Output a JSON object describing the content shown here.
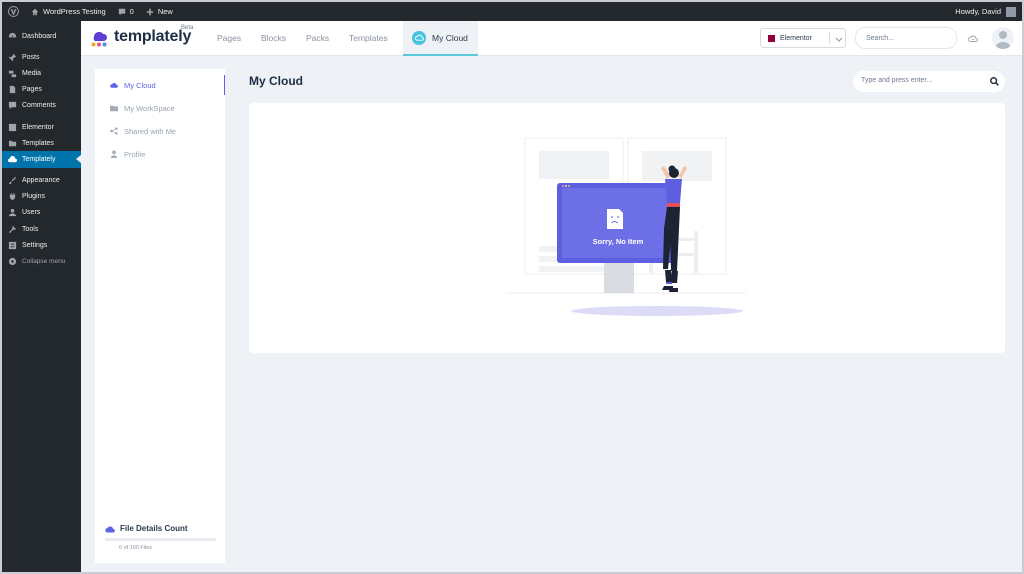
{
  "admin_bar": {
    "site_name": "WordPress Testing",
    "comments_count": "0",
    "new_label": "New",
    "howdy": "Howdy, David"
  },
  "sidebar": {
    "items": [
      {
        "label": "Dashboard",
        "icon": "dashboard-icon"
      },
      {
        "label": "Posts",
        "icon": "pin-icon"
      },
      {
        "label": "Media",
        "icon": "media-icon"
      },
      {
        "label": "Pages",
        "icon": "pages-icon"
      },
      {
        "label": "Comments",
        "icon": "comments-icon"
      },
      {
        "label": "Elementor",
        "icon": "elementor-icon"
      },
      {
        "label": "Templates",
        "icon": "folder-icon"
      },
      {
        "label": "Templately",
        "icon": "templately-icon",
        "active": true
      },
      {
        "label": "Appearance",
        "icon": "brush-icon"
      },
      {
        "label": "Plugins",
        "icon": "plug-icon"
      },
      {
        "label": "Users",
        "icon": "users-icon"
      },
      {
        "label": "Tools",
        "icon": "wrench-icon"
      },
      {
        "label": "Settings",
        "icon": "settings-icon"
      }
    ],
    "collapse_label": "Collapse menu"
  },
  "header": {
    "logo_text": "templately",
    "logo_badge": "Beta",
    "tabs": [
      "Pages",
      "Blocks",
      "Packs",
      "Templates",
      "My Cloud"
    ],
    "active_tab": "My Cloud",
    "platform_selected": "Elementor",
    "search_placeholder": "Search..."
  },
  "left_panel": {
    "items": [
      {
        "label": "My Cloud",
        "icon": "cloud-icon",
        "active": true
      },
      {
        "label": "My WorkSpace",
        "icon": "folder-icon"
      },
      {
        "label": "Shared with Me",
        "icon": "share-icon"
      },
      {
        "label": "Profile",
        "icon": "user-icon"
      }
    ],
    "file_details_title": "File Details Count",
    "file_count_text": "0 of 100 Files",
    "file_used_fraction": 0
  },
  "main": {
    "title": "My Cloud",
    "search_placeholder": "Type and press enter...",
    "empty_text": "Sorry, No Item"
  },
  "colors": {
    "accent": "#5d63e6",
    "wp_active": "#0073aa",
    "admin_bg": "#23282d",
    "cloud_tab": "#47c3dc"
  }
}
